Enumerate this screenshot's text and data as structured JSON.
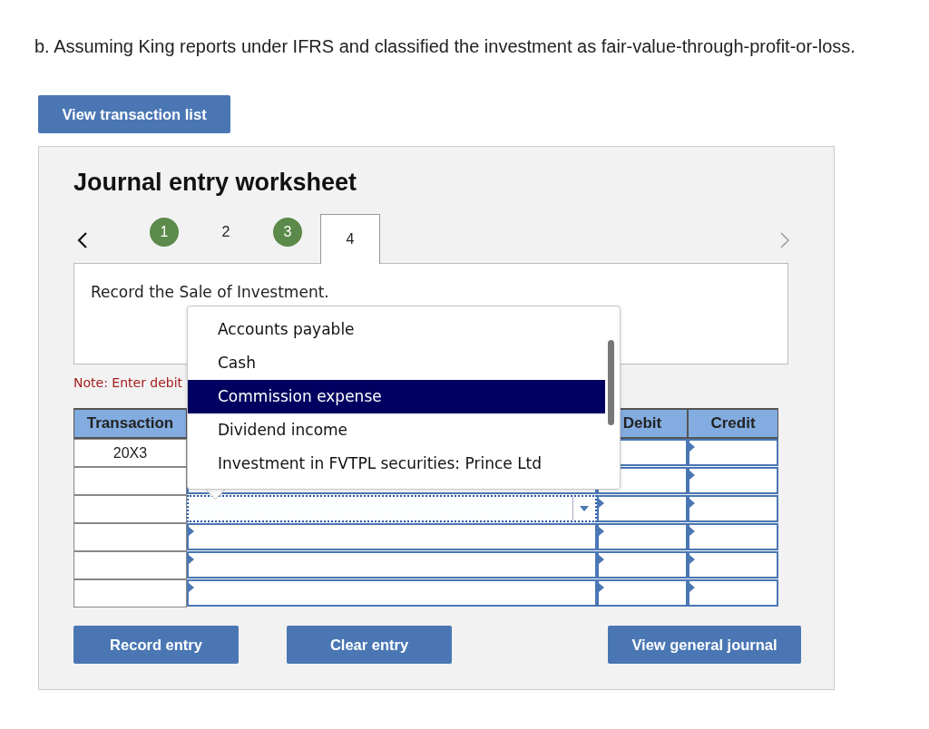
{
  "question": "b. Assuming King reports under IFRS and classified the investment as fair-value-through-profit-or-loss.",
  "transaction_list_button": "View transaction list",
  "worksheet": {
    "title": "Journal entry worksheet",
    "prev": {
      "disabled": false
    },
    "next": {
      "disabled": true
    },
    "tabs": [
      {
        "label": "1",
        "done": true,
        "selected": false
      },
      {
        "label": "2",
        "done": false,
        "selected": false
      },
      {
        "label": "3",
        "done": true,
        "selected": false
      },
      {
        "label": "4",
        "done": false,
        "selected": true
      }
    ],
    "instruction": "Record the Sale of Investment.",
    "note": "Note: Enter debit",
    "table": {
      "columns": {
        "transaction": "Transaction",
        "debit": "Debit",
        "credit": "Credit"
      },
      "rows": [
        {
          "transaction": "20X3",
          "focused": false
        },
        {
          "transaction": "",
          "focused": false
        },
        {
          "transaction": "",
          "focused": true
        },
        {
          "transaction": "",
          "focused": false
        },
        {
          "transaction": "",
          "focused": false
        },
        {
          "transaction": "",
          "focused": false
        }
      ]
    },
    "dropdown": {
      "items": [
        {
          "label": "Accounts payable",
          "selected": false
        },
        {
          "label": "Cash",
          "selected": false
        },
        {
          "label": "Commission expense",
          "selected": true
        },
        {
          "label": "Dividend income",
          "selected": false
        },
        {
          "label": "Investment in FVTPL securities: Prince Ltd",
          "selected": false
        }
      ]
    },
    "buttons": [
      "Record entry",
      "Clear entry",
      "View general journal"
    ]
  }
}
